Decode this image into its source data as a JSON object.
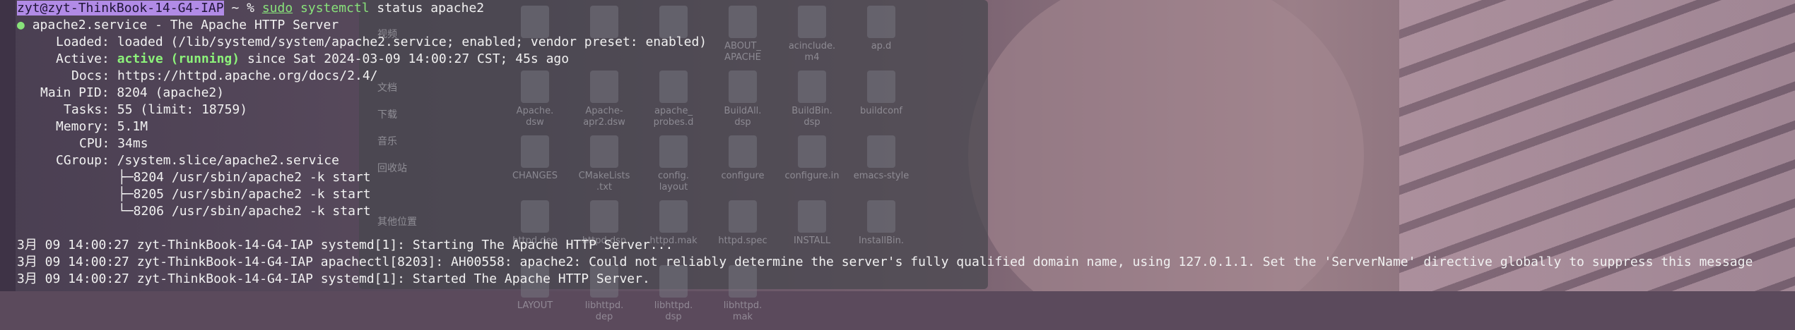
{
  "prompt": {
    "userhost": "zyt@zyt-ThinkBook-14-G4-IAP",
    "cwd_symbol": "~ %",
    "cmd_sudo": "sudo",
    "cmd_systemctl": "systemctl",
    "cmd_args": "status apache2"
  },
  "service": {
    "header": "apache2.service - The Apache HTTP Server",
    "loaded": "loaded (/lib/systemd/system/apache2.service; enabled; vendor preset: enabled)",
    "active_state": "active (running)",
    "active_since": "since Sat 2024-03-09 14:00:27 CST; 45s ago",
    "docs": "https://httpd.apache.org/docs/2.4/",
    "main_pid": "8204 (apache2)",
    "tasks": "55 (limit: 18759)",
    "memory": "5.1M",
    "cpu": "34ms",
    "cgroup": "/system.slice/apache2.service",
    "processes": [
      "├─8204 /usr/sbin/apache2 -k start",
      "├─8205 /usr/sbin/apache2 -k start",
      "└─8206 /usr/sbin/apache2 -k start"
    ]
  },
  "labels": {
    "loaded": "Loaded:",
    "active": "Active:",
    "docs": "Docs:",
    "main_pid": "Main PID:",
    "tasks": "Tasks:",
    "memory": "Memory:",
    "cpu": "CPU:",
    "cgroup": "CGroup:"
  },
  "logs": [
    "3月 09 14:00:27 zyt-ThinkBook-14-G4-IAP systemd[1]: Starting The Apache HTTP Server...",
    "3月 09 14:00:27 zyt-ThinkBook-14-G4-IAP apachectl[8203]: AH00558: apache2: Could not reliably determine the server's fully qualified domain name, using 127.0.1.1. Set the 'ServerName' directive globally to suppress this message",
    "3月 09 14:00:27 zyt-ThinkBook-14-G4-IAP systemd[1]: Started The Apache HTTP Server."
  ],
  "file_manager": {
    "sidebar": [
      "视频",
      "",
      "文档",
      "下载",
      "音乐",
      "回收站",
      "",
      "其他位置"
    ],
    "files": [
      "",
      "",
      "",
      "ABOUT_\nAPACHE",
      "acinclude.\nm4",
      "ap.d",
      "Apache.\ndsw",
      "Apache-\napr2.dsw",
      "apache_\nprobes.d",
      "BuildAll.\ndsp",
      "BuildBin.\ndsp",
      "buildconf",
      "CHANGES",
      "CMakeLists\n.txt",
      "config.\nlayout",
      "configure",
      "configure.in",
      "emacs-style",
      "httpd.dep",
      "httpd.dsp",
      "httpd.mak",
      "httpd.spec",
      "INSTALL",
      "InstallBin.",
      "LAYOUT",
      "libhttpd.\ndep",
      "libhttpd.\ndsp",
      "libhttpd.\nmak"
    ]
  }
}
